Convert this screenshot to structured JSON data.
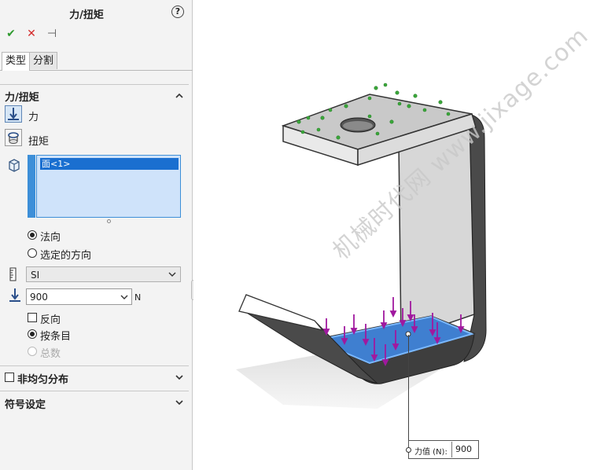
{
  "panel": {
    "title": "力/扭矩",
    "help_glyph": "?",
    "actions": {
      "ok": "✔",
      "cancel": "✕",
      "pin": "⊣"
    },
    "tabs": [
      "类型",
      "分割"
    ],
    "force_torque": {
      "title": "力/扭矩",
      "force_label": "力",
      "torque_label": "扭矩",
      "face_list": [
        "面<1>"
      ],
      "direction_options": [
        "法向",
        "选定的方向"
      ],
      "direction_selected": "法向",
      "unit_system": "SI",
      "force_value": "900",
      "force_unit": "N",
      "reverse_label": "反向",
      "reverse_checked": false,
      "distribution_options": [
        "按条目",
        "总数"
      ],
      "distribution_selected": "按条目"
    },
    "nonuniform": {
      "label": "非均匀分布",
      "checked": false
    },
    "symbol_settings": {
      "title": "符号设定"
    }
  },
  "viewport": {
    "callout": {
      "label": "力值 (N):",
      "value": "900"
    },
    "watermark": "机械时代网  www.jixage.com",
    "colors": {
      "selected_face": "#3f7fd0",
      "force_arrow": "#a0199f",
      "fixture": "#3aa83a"
    }
  }
}
